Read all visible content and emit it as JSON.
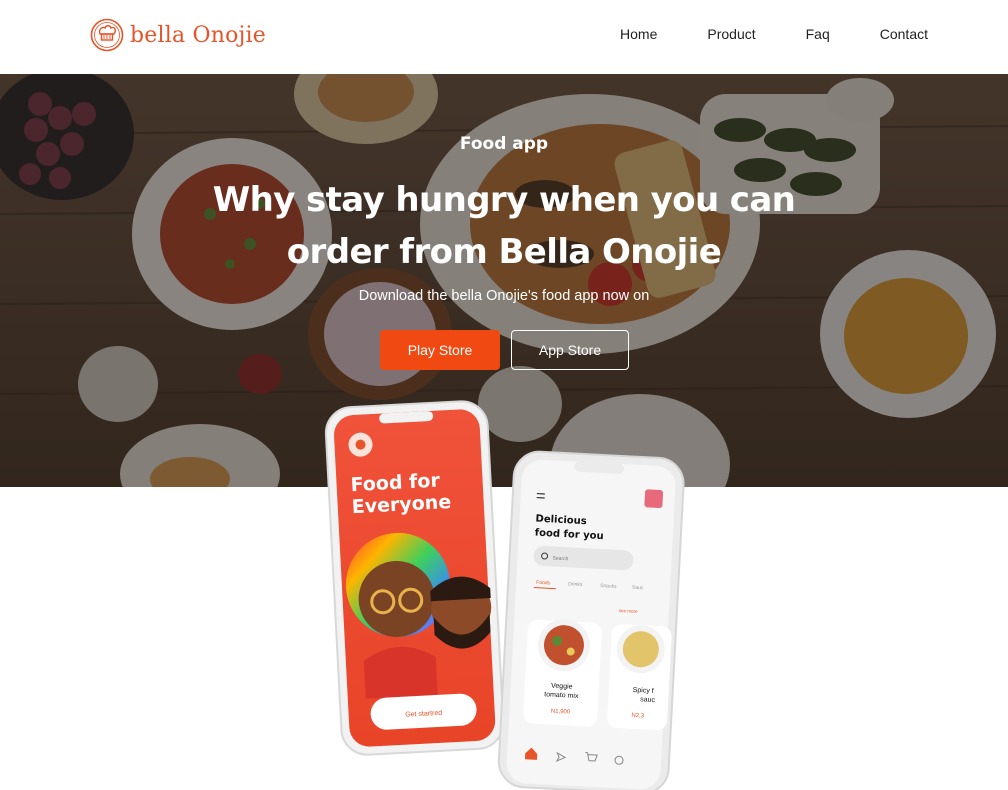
{
  "brand": {
    "name": "bella Onojie",
    "accent": "#e8542a"
  },
  "nav": {
    "items": [
      "Home",
      "Product",
      "Faq",
      "Contact"
    ]
  },
  "hero": {
    "eyebrow": "Food app",
    "headline": "Why stay hungry when you can order from Bella Onojie",
    "subtext": "Download the bella Onojie's food app now on",
    "play_store": "Play Store",
    "app_store": "App Store",
    "button_color": "#f04a12"
  },
  "phone_left": {
    "title_line1": "Food for",
    "title_line2": "Everyone",
    "cta": "Get startred"
  },
  "phone_right": {
    "heading_line1": "Delicious",
    "heading_line2": "food for you",
    "search_placeholder": "Search",
    "tabs": [
      "Foods",
      "Drinks",
      "Snacks",
      "Sauc"
    ],
    "see_more": "see more",
    "card1": {
      "name_line1": "Veggie",
      "name_line2": "tomato mix",
      "price": "N1,900"
    },
    "card2": {
      "name_line1": "Spicy f",
      "name_line2": "sauc",
      "price": "N2,3"
    }
  }
}
